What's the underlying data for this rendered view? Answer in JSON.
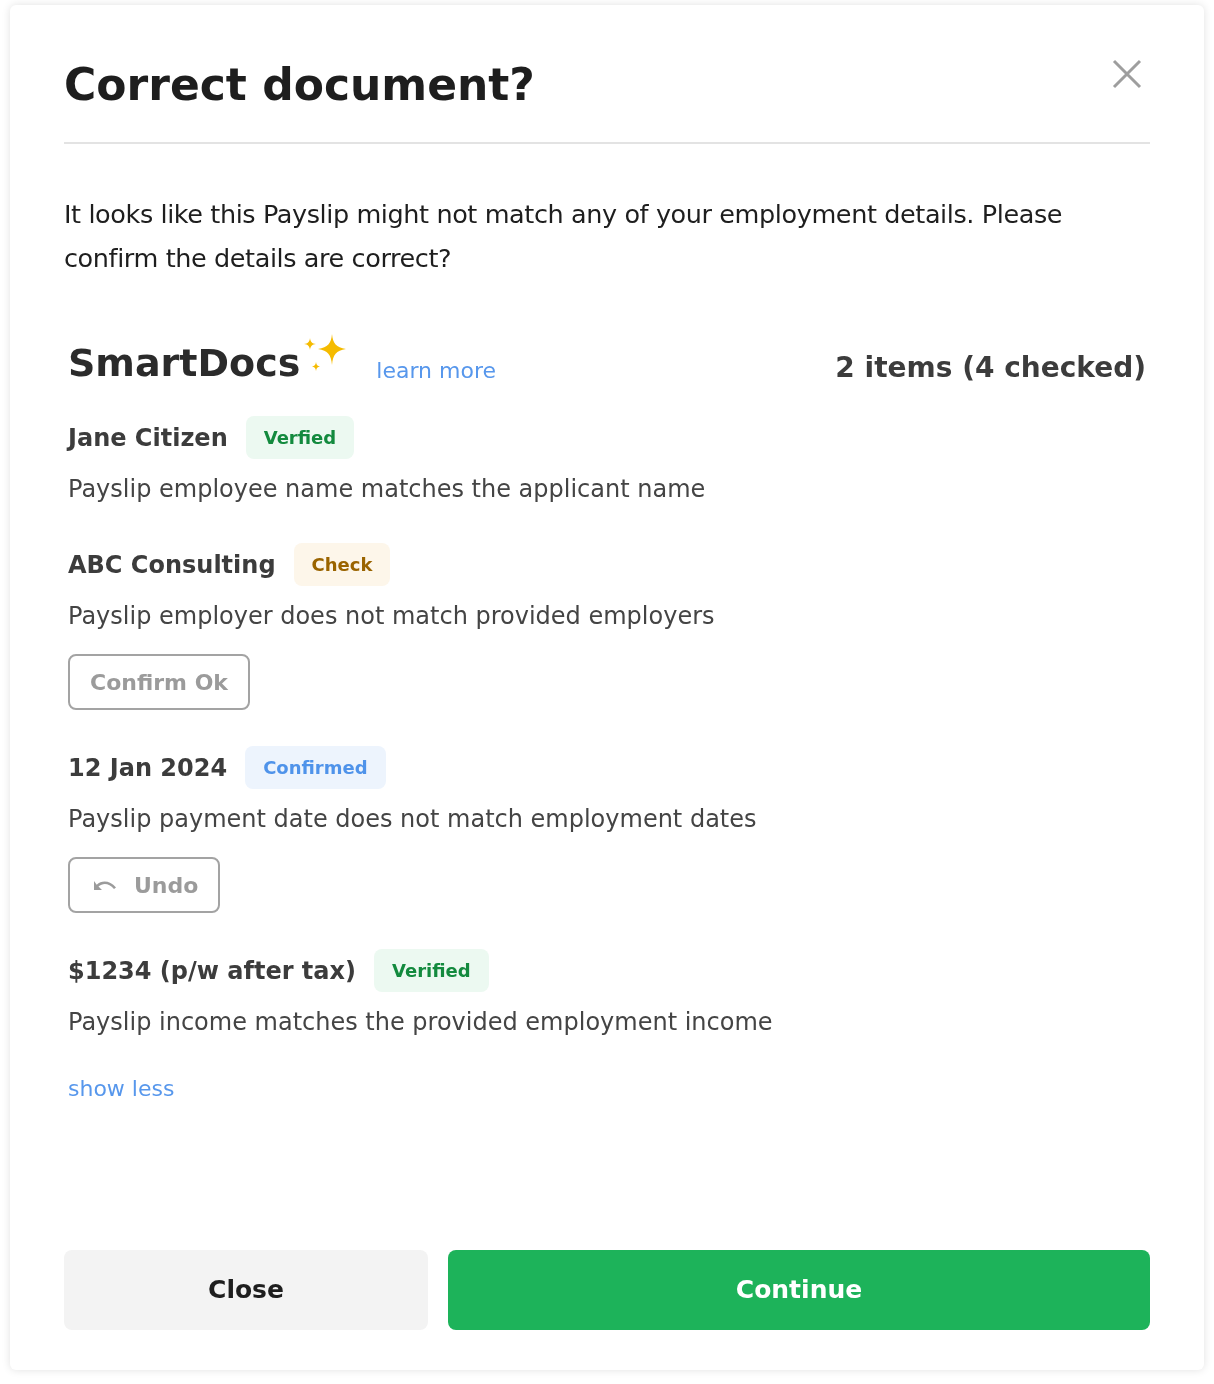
{
  "dialog": {
    "title": "Correct document?",
    "message": "It looks like this Payslip might not match any of your employment details. Please confirm the details are correct?"
  },
  "smartdocs": {
    "brand": "SmartDocs",
    "learn_more": "learn more",
    "summary": "2 items (4 checked)"
  },
  "items": [
    {
      "value": "Jane Citizen",
      "badge": "Verfied",
      "kind": "verified",
      "description": "Payslip employee name matches the applicant name"
    },
    {
      "value": "ABC Consulting",
      "badge": "Check",
      "kind": "check",
      "description": "Payslip employer does not match provided employers",
      "action": {
        "kind": "confirm",
        "label": "Confirm Ok"
      }
    },
    {
      "value": "12 Jan 2024",
      "badge": "Confirmed",
      "kind": "confirmed",
      "description": "Payslip payment date does not match employment dates",
      "action": {
        "kind": "undo",
        "label": "Undo"
      }
    },
    {
      "value": "$1234 (p/w after tax)",
      "badge": "Verified",
      "kind": "verified",
      "description": "Payslip income matches the provided employment income"
    }
  ],
  "show_less": "show less",
  "buttons": {
    "close": "Close",
    "continue": "Continue"
  }
}
